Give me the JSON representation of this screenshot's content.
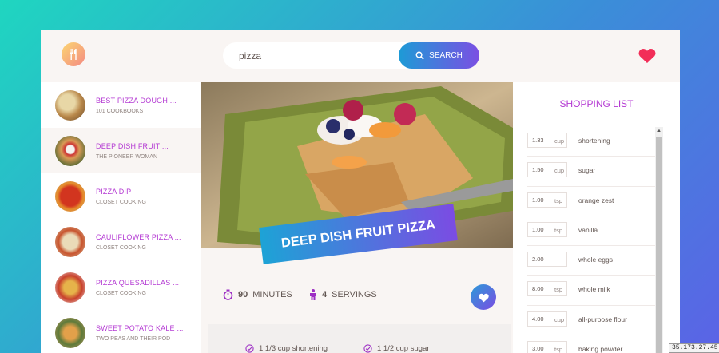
{
  "header": {
    "search_value": "pizza",
    "search_button_label": "SEARCH"
  },
  "results": [
    {
      "title": "BEST PIZZA DOUGH ...",
      "publisher": "101 COOKBOOKS"
    },
    {
      "title": "DEEP DISH FRUIT ...",
      "publisher": "THE PIONEER WOMAN"
    },
    {
      "title": "PIZZA DIP",
      "publisher": "CLOSET COOKING"
    },
    {
      "title": "CAULIFLOWER PIZZA ...",
      "publisher": "CLOSET COOKING"
    },
    {
      "title": "PIZZA QUESADILLAS ...",
      "publisher": "CLOSET COOKING"
    },
    {
      "title": "SWEET POTATO KALE ...",
      "publisher": "TWO PEAS AND THEIR POD"
    }
  ],
  "recipe": {
    "title": "DEEP DISH FRUIT PIZZA",
    "minutes": "90",
    "minutes_label": "MINUTES",
    "servings": "4",
    "servings_label": "SERVINGS",
    "ingredients": [
      "1 1/3 cup shortening",
      "1 1/2 cup sugar"
    ]
  },
  "shopping": {
    "heading": "SHOPPING LIST",
    "items": [
      {
        "qty": "1.33",
        "unit": "cup",
        "desc": "shortening"
      },
      {
        "qty": "1.50",
        "unit": "cup",
        "desc": "sugar"
      },
      {
        "qty": "1.00",
        "unit": "tsp",
        "desc": "orange zest"
      },
      {
        "qty": "1.00",
        "unit": "tsp",
        "desc": "vanilla"
      },
      {
        "qty": "2.00",
        "unit": "",
        "desc": "whole eggs"
      },
      {
        "qty": "8.00",
        "unit": "tsp",
        "desc": "whole milk"
      },
      {
        "qty": "4.00",
        "unit": "cup",
        "desc": "all-purpose flour"
      },
      {
        "qty": "3.00",
        "unit": "tsp",
        "desc": "baking powder"
      }
    ]
  },
  "overlay_ip": "35.173.27.45",
  "colors": {
    "accent": "#b43ad3",
    "heart": "#f22e58"
  }
}
